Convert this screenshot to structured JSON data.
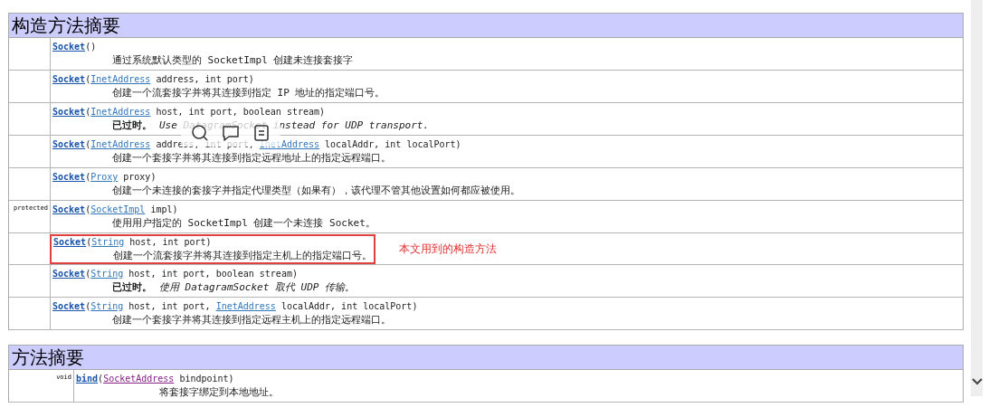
{
  "sections": [
    {
      "title": "构造方法摘要",
      "rows": [
        {
          "modifier": "",
          "signature": [
            {
              "kind": "member",
              "text": "Socket"
            },
            {
              "kind": "plain",
              "text": "()"
            }
          ],
          "description": {
            "text": "通过系统默认类型的 SocketImpl 创建未连接套接字"
          }
        },
        {
          "modifier": "",
          "signature": [
            {
              "kind": "member",
              "text": "Socket"
            },
            {
              "kind": "plain",
              "text": "("
            },
            {
              "kind": "type",
              "text": "InetAddress"
            },
            {
              "kind": "plain",
              "text": " address, int port)"
            }
          ],
          "description": {
            "text": "创建一个流套接字并将其连接到指定 IP 地址的指定端口号。"
          }
        },
        {
          "modifier": "",
          "signature": [
            {
              "kind": "member",
              "text": "Socket"
            },
            {
              "kind": "plain",
              "text": "("
            },
            {
              "kind": "type",
              "text": "InetAddress"
            },
            {
              "kind": "plain",
              "text": " host, int port, boolean stream)"
            }
          ],
          "description": {
            "deprecated": "已过时。",
            "text": "Use DatagramSocket instead for UDP transport."
          }
        },
        {
          "modifier": "",
          "popup": true,
          "signature": [
            {
              "kind": "member",
              "text": "Socket"
            },
            {
              "kind": "plain",
              "text": "("
            },
            {
              "kind": "type",
              "text": "InetAddress"
            },
            {
              "kind": "plain",
              "text": " address, int port, "
            },
            {
              "kind": "type",
              "text": "InetAddress"
            },
            {
              "kind": "plain",
              "text": " localAddr, int localPort)"
            }
          ],
          "description": {
            "text": "创建一个套接字并将其连接到指定远程地址上的指定远程端口。"
          }
        },
        {
          "modifier": "",
          "signature": [
            {
              "kind": "member",
              "text": "Socket"
            },
            {
              "kind": "plain",
              "text": "("
            },
            {
              "kind": "type",
              "text": "Proxy"
            },
            {
              "kind": "plain",
              "text": " proxy)"
            }
          ],
          "description": {
            "text": "创建一个未连接的套接字并指定代理类型（如果有），该代理不管其他设置如何都应被使用。"
          }
        },
        {
          "modifier": "protected",
          "signature": [
            {
              "kind": "member",
              "text": "Socket"
            },
            {
              "kind": "plain",
              "text": "("
            },
            {
              "kind": "type",
              "text": "SocketImpl"
            },
            {
              "kind": "plain",
              "text": " impl)"
            }
          ],
          "description": {
            "text": "使用用户指定的 SocketImpl 创建一个未连接 Socket。"
          }
        },
        {
          "modifier": "",
          "highlighted": true,
          "note": "本文用到的构造方法",
          "signature": [
            {
              "kind": "member",
              "text": "Socket"
            },
            {
              "kind": "plain",
              "text": "("
            },
            {
              "kind": "type",
              "text": "String"
            },
            {
              "kind": "plain",
              "text": " host, int port)"
            }
          ],
          "description": {
            "text": "创建一个流套接字并将其连接到指定主机上的指定端口号。"
          }
        },
        {
          "modifier": "",
          "signature": [
            {
              "kind": "member",
              "text": "Socket"
            },
            {
              "kind": "plain",
              "text": "("
            },
            {
              "kind": "type",
              "text": "String"
            },
            {
              "kind": "plain",
              "text": " host, int port, boolean stream)"
            }
          ],
          "description": {
            "deprecated": "已过时。",
            "text": "使用 DatagramSocket 取代 UDP 传输。"
          }
        },
        {
          "modifier": "",
          "signature": [
            {
              "kind": "member",
              "text": "Socket"
            },
            {
              "kind": "plain",
              "text": "("
            },
            {
              "kind": "type",
              "text": "String"
            },
            {
              "kind": "plain",
              "text": " host, int port, "
            },
            {
              "kind": "type",
              "text": "InetAddress"
            },
            {
              "kind": "plain",
              "text": " localAddr, int localPort)"
            }
          ],
          "description": {
            "text": "创建一个套接字并将其连接到指定远程主机上的指定远程端口。"
          }
        }
      ]
    },
    {
      "title": "方法摘要",
      "rows": [
        {
          "modifier": "void",
          "signature": [
            {
              "kind": "member",
              "text": "bind"
            },
            {
              "kind": "plain",
              "text": "("
            },
            {
              "kind": "visited-type",
              "text": "SocketAddress"
            },
            {
              "kind": "plain",
              "text": " bindpoint)"
            }
          ],
          "description": {
            "text": "将套接字绑定到本地地址。"
          }
        }
      ]
    }
  ]
}
